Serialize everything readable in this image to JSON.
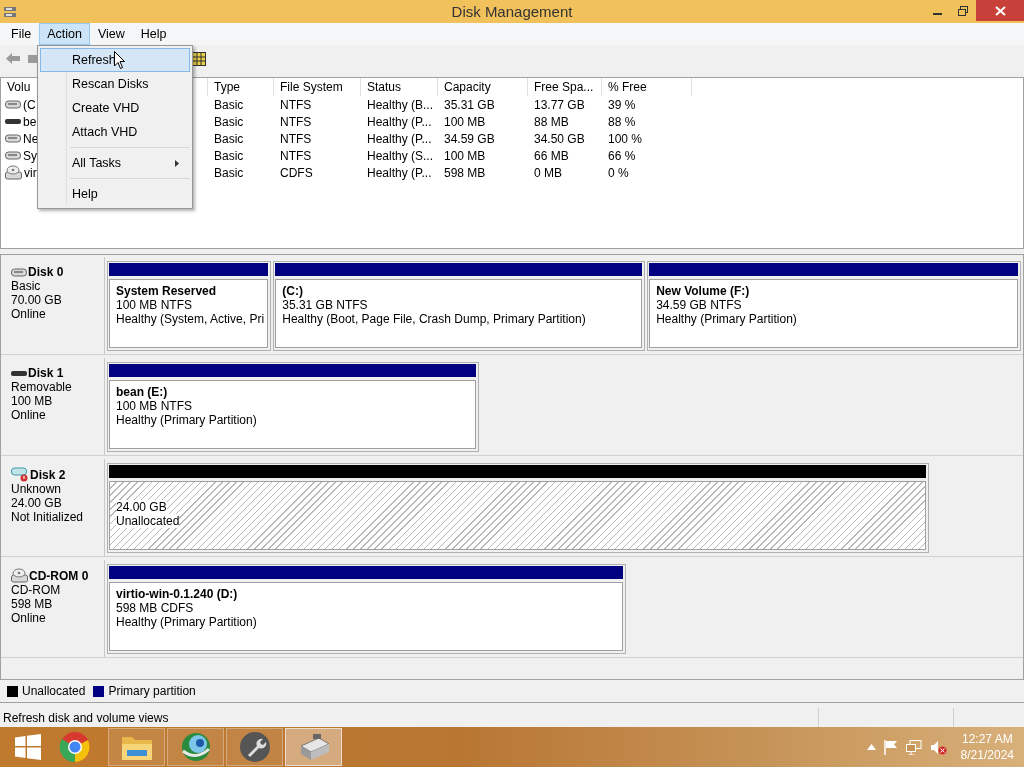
{
  "window": {
    "title": "Disk Management"
  },
  "menu_bar": [
    {
      "label": "File",
      "selected": false
    },
    {
      "label": "Action",
      "selected": true
    },
    {
      "label": "View",
      "selected": false
    },
    {
      "label": "Help",
      "selected": false
    }
  ],
  "action_menu": [
    {
      "kind": "item",
      "label": "Refresh",
      "selected": true
    },
    {
      "kind": "item",
      "label": "Rescan Disks",
      "selected": false
    },
    {
      "kind": "item",
      "label": "Create VHD",
      "selected": false
    },
    {
      "kind": "item",
      "label": "Attach VHD",
      "selected": false
    },
    {
      "kind": "separator"
    },
    {
      "kind": "submenu",
      "label": "All Tasks",
      "selected": false
    },
    {
      "kind": "separator"
    },
    {
      "kind": "item",
      "label": "Help",
      "selected": false
    }
  ],
  "volume_list": {
    "columns": [
      "Volu",
      "Type",
      "File System",
      "Status",
      "Capacity",
      "Free Spa...",
      "% Free"
    ],
    "rows": [
      {
        "kind": "disk",
        "cells": [
          "(C",
          "Basic",
          "NTFS",
          "Healthy (B...",
          "35.31 GB",
          "13.77 GB",
          "39 %"
        ]
      },
      {
        "kind": "removable",
        "cells": [
          "be",
          "Basic",
          "NTFS",
          "Healthy (P...",
          "100 MB",
          "88 MB",
          "88 %"
        ]
      },
      {
        "kind": "disk",
        "cells": [
          "Ne",
          "Basic",
          "NTFS",
          "Healthy (P...",
          "34.59 GB",
          "34.50 GB",
          "100 %"
        ]
      },
      {
        "kind": "disk",
        "cells": [
          "Sy",
          "Basic",
          "NTFS",
          "Healthy (S...",
          "100 MB",
          "66 MB",
          "66 %"
        ]
      },
      {
        "kind": "cd",
        "cells": [
          "vir",
          "Basic",
          "CDFS",
          "Healthy (P...",
          "598 MB",
          "0 MB",
          "0 %"
        ]
      }
    ]
  },
  "disks": [
    {
      "kind": "disk",
      "name": "Disk 0",
      "type": "Basic",
      "size": "70.00 GB",
      "status": "Online",
      "partitions": [
        {
          "kind": "primary",
          "name": "System Reserved",
          "size": "100 MB NTFS",
          "status": "Healthy (System, Active, Pri"
        },
        {
          "kind": "primary",
          "name": "(C:)",
          "size": "35.31 GB NTFS",
          "status": "Healthy (Boot, Page File, Crash Dump, Primary Partition)"
        },
        {
          "kind": "primary",
          "name": "New Volume  (F:)",
          "size": "34.59 GB NTFS",
          "status": "Healthy (Primary Partition)"
        }
      ]
    },
    {
      "kind": "removable",
      "name": "Disk 1",
      "type": "Removable",
      "size": "100 MB",
      "status": "Online",
      "partitions": [
        {
          "kind": "primary",
          "name": "bean  (E:)",
          "size": "100 MB NTFS",
          "status": "Healthy (Primary Partition)"
        }
      ]
    },
    {
      "kind": "unknown",
      "name": "Disk 2",
      "type": "Unknown",
      "size": "24.00 GB",
      "status": "Not Initialized",
      "partitions": [
        {
          "kind": "unallocated",
          "size": "24.00 GB",
          "status": "Unallocated"
        }
      ]
    },
    {
      "kind": "cd",
      "name": "CD-ROM 0",
      "type": "CD-ROM",
      "size": "598 MB",
      "status": "Online",
      "partitions": [
        {
          "kind": "primary",
          "name": "virtio-win-0.1.240  (D:)",
          "size": "598 MB CDFS",
          "status": "Healthy (Primary Partition)"
        }
      ]
    }
  ],
  "legend": [
    {
      "label": "Unallocated",
      "color": "#000000"
    },
    {
      "label": "Primary partition",
      "color": "#000080"
    }
  ],
  "status_bar": {
    "text": "Refresh disk and volume views"
  },
  "taskbar": {
    "apps": [
      {
        "kind": "browser",
        "selected": false
      },
      {
        "kind": "folder",
        "selected": false
      },
      {
        "kind": "globe",
        "selected": false
      },
      {
        "kind": "wrench",
        "selected": false
      },
      {
        "kind": "diskmgmt",
        "selected": true
      }
    ],
    "time": "12:27 AM",
    "date": "8/21/2024"
  }
}
